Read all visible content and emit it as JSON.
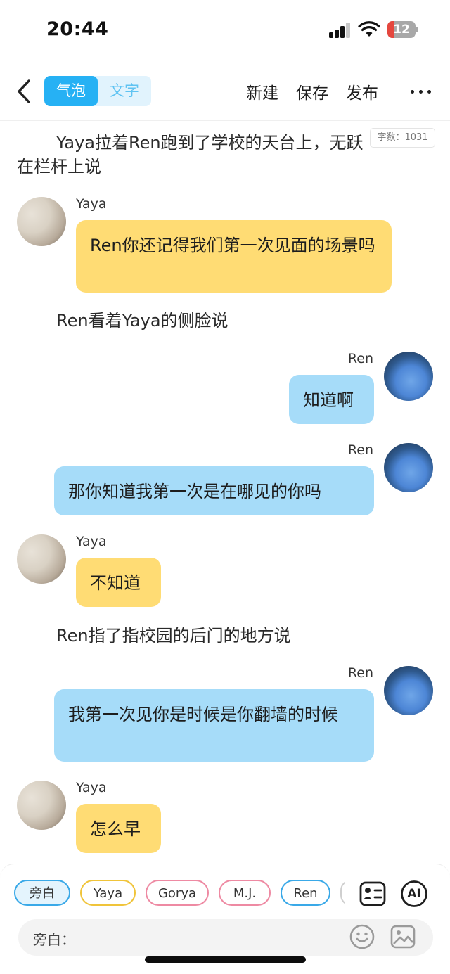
{
  "status_bar": {
    "time": "20:44",
    "battery": "12",
    "battery_color": "#e5473e"
  },
  "nav": {
    "tabs": [
      {
        "label": "气泡",
        "active": true
      },
      {
        "label": "文字",
        "active": false
      }
    ],
    "actions": {
      "new": "新建",
      "save": "保存",
      "publish": "发布"
    },
    "more_icon": "ellipsis-icon",
    "back_icon": "chevron-left-icon"
  },
  "word_count": "字数：1031",
  "story": {
    "narration_1": "Yaya拉着Ren跑到了学校的天台上，无跃",
    "narration_1b": "在栏杆上说",
    "narration_2": "Ren看着Yaya的侧脸说",
    "narration_3": "Ren指了指校园的后门的地方说",
    "messages": [
      {
        "sender": "Yaya",
        "text": "Ren你还记得我们第一次见面的场景吗",
        "side": "left"
      },
      {
        "sender": "Ren",
        "text": "知道啊",
        "side": "right"
      },
      {
        "sender": "Ren",
        "text": "那你知道我第一次是在哪见的你吗",
        "side": "right"
      },
      {
        "sender": "Yaya",
        "text": "不知道",
        "side": "left"
      },
      {
        "sender": "Ren",
        "text": "我第一次见你是时候是你翻墙的时候",
        "side": "right"
      },
      {
        "sender": "Yaya",
        "text": "怎么早",
        "side": "left"
      }
    ]
  },
  "colors": {
    "accent": "#26b1f4",
    "yellow_bubble": "#ffdc74",
    "blue_bubble": "#a6dcf9"
  },
  "bottom": {
    "chips": [
      {
        "label": "旁白",
        "color": "#3aa9e8",
        "active": true
      },
      {
        "label": "Yaya",
        "color": "#f0c43a",
        "active": false
      },
      {
        "label": "Gorya",
        "color": "#ee8aa3",
        "active": false
      },
      {
        "label": "M.J.",
        "color": "#ee8aa3",
        "active": false
      },
      {
        "label": "Ren",
        "color": "#3aa9e8",
        "active": false
      }
    ],
    "ai_label": "AI",
    "input_label": "旁白："
  }
}
